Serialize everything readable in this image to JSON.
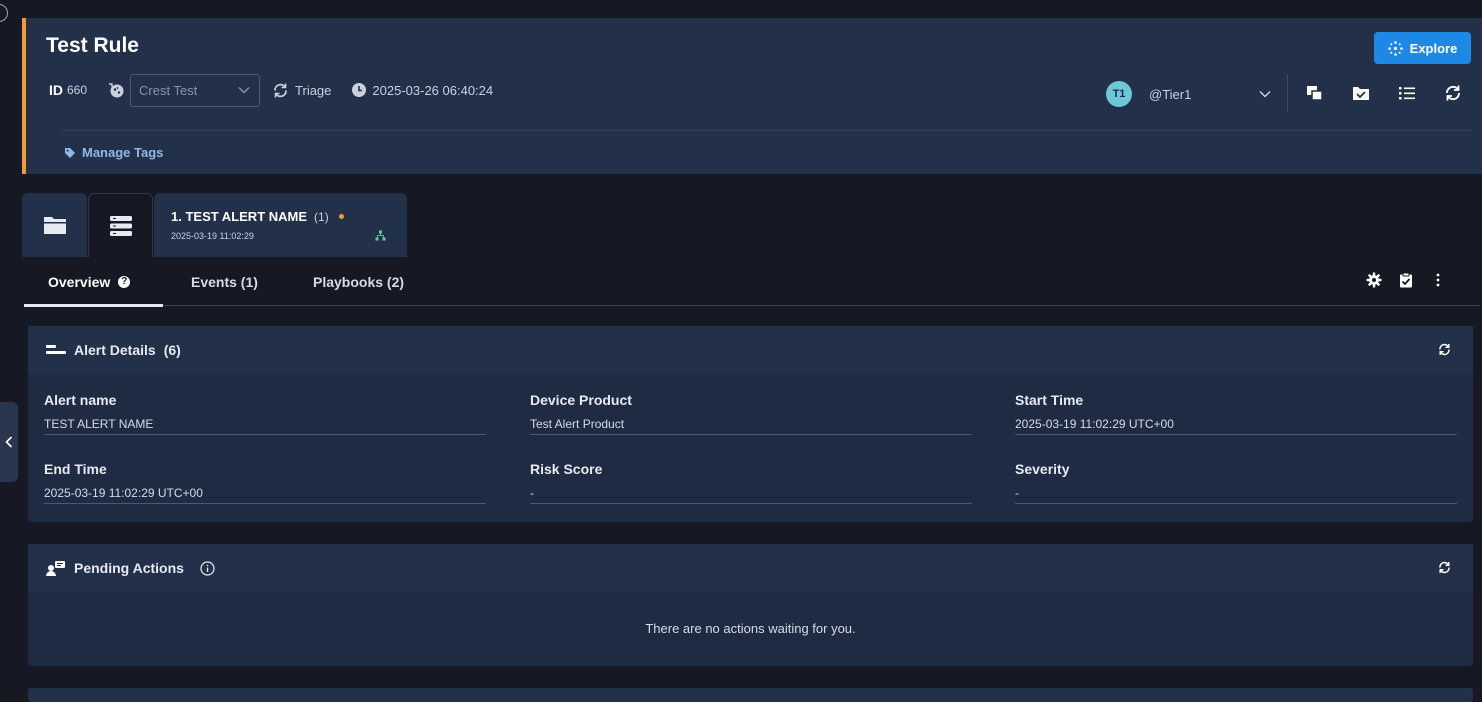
{
  "header": {
    "title": "Test Rule",
    "explore_label": "Explore",
    "id_label": "ID",
    "id_value": "660",
    "environment": "Crest Test",
    "stage": "Triage",
    "timestamp": "2025-03-26 06:40:24",
    "assignee_initials": "T1",
    "assignee_name": "@Tier1",
    "manage_tags_label": "Manage Tags"
  },
  "alert_tab": {
    "title": "1. TEST ALERT NAME",
    "count": "(1)",
    "time": "2025-03-19 11:02:29"
  },
  "subtabs": [
    {
      "label": "Overview"
    },
    {
      "label": "Events (1)"
    },
    {
      "label": "Playbooks (2)"
    }
  ],
  "alert_details": {
    "title": "Alert Details",
    "count": "(6)",
    "fields": [
      {
        "label": "Alert name",
        "value": "TEST ALERT NAME"
      },
      {
        "label": "Device Product",
        "value": "Test Alert Product"
      },
      {
        "label": "Start Time",
        "value": "2025-03-19 11:02:29 UTC+00"
      },
      {
        "label": "End Time",
        "value": "2025-03-19 11:02:29 UTC+00"
      },
      {
        "label": "Risk Score",
        "value": "-"
      },
      {
        "label": "Severity",
        "value": "-"
      }
    ]
  },
  "pending_actions": {
    "title": "Pending Actions",
    "empty_message": "There are no actions waiting for you."
  },
  "colors": {
    "accent": "#1e88e5",
    "priority_bar": "#f29b3a",
    "avatar": "#6cc7d8"
  }
}
